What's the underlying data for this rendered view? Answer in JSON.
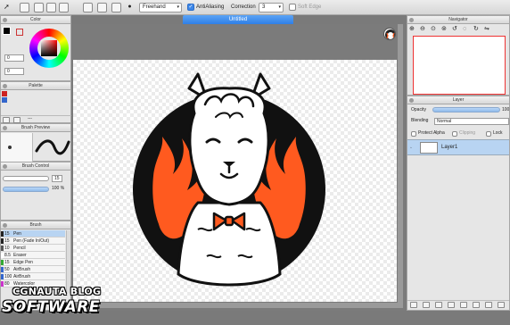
{
  "toolbar": {
    "brush_mode": "Freehand",
    "antialiasing_label": "AntiAliasing",
    "correction_label": "Correction",
    "correction_value": "3",
    "soft_edge_label": "Soft Edge"
  },
  "document": {
    "tab_title": "Untitled"
  },
  "color_panel": {
    "title": "Color",
    "fields": [
      "0",
      "0",
      "0"
    ]
  },
  "palette_panel": {
    "title": "Palette",
    "menu_text": "---"
  },
  "brush_preview_panel": {
    "title": "Brush Preview"
  },
  "brush_control_panel": {
    "title": "Brush Control",
    "size_value": "15",
    "opacity_value": "100 %"
  },
  "brush_panel": {
    "title": "Brush",
    "items": [
      {
        "size": "15",
        "name": "Pen",
        "color": "#222222",
        "selected": true
      },
      {
        "size": "15",
        "name": "Pen (Fade In/Out)",
        "color": "#222222",
        "selected": false
      },
      {
        "size": "10",
        "name": "Pencil",
        "color": "#555555",
        "selected": false
      },
      {
        "size": "8.5",
        "name": "Eraser",
        "color": "#ffffff",
        "selected": false
      },
      {
        "size": "15",
        "name": "Edge Pen",
        "color": "#33aa33",
        "selected": false
      },
      {
        "size": "50",
        "name": "AirBrush",
        "color": "#3366cc",
        "selected": false
      },
      {
        "size": "100",
        "name": "AirBrush",
        "color": "#3366cc",
        "selected": false
      },
      {
        "size": "80",
        "name": "Watercolor",
        "color": "#cc33cc",
        "selected": false
      }
    ]
  },
  "navigator_panel": {
    "title": "Navigator"
  },
  "layer_panel": {
    "title": "Layer",
    "opacity_label": "Opacity",
    "opacity_value": "100",
    "blending_label": "Blending",
    "blending_value": "Normal",
    "protect_alpha_label": "Protect Alpha",
    "clipping_label": "Clipping",
    "lock_label": "Lock",
    "layers": [
      {
        "name": "Layer1"
      }
    ]
  },
  "watermark": {
    "line1": "CGNAUTA BLOG",
    "line2": "SOFTWARE"
  },
  "colors": {
    "accent": "#3d87e8",
    "flame": "#ff5a1f",
    "panel_bg": "#e6e6e6"
  }
}
